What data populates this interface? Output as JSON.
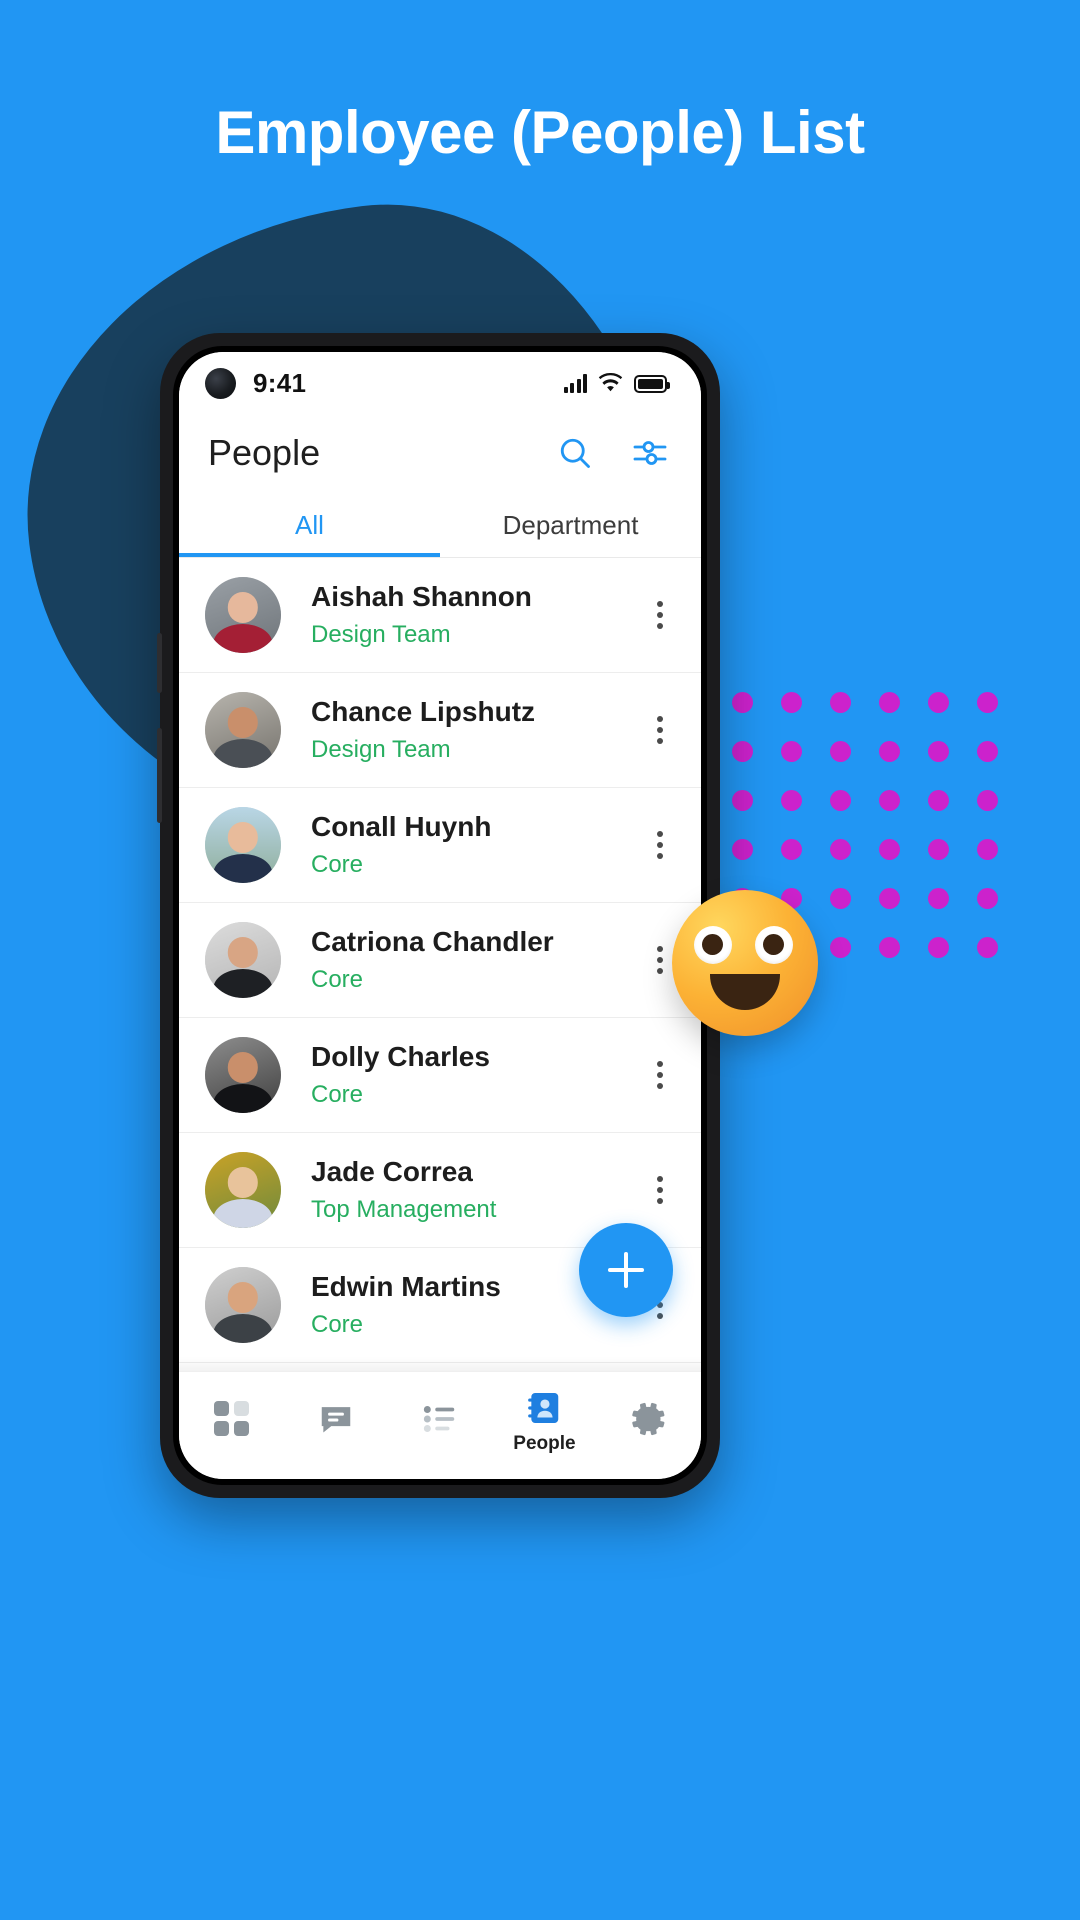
{
  "headline": "Employee (People) List",
  "colors": {
    "background": "#2196f3",
    "blob": "#18405e",
    "dots": "#cc22cc",
    "accent": "#2196f3",
    "department_green": "#27ae60"
  },
  "phone": {
    "status_bar": {
      "time": "9:41",
      "signal_icon": "signal-bars-icon",
      "wifi_icon": "wifi-icon",
      "battery_icon": "battery-full-icon"
    },
    "app_bar": {
      "title": "People",
      "search_icon": "search-icon",
      "filter_icon": "sliders-filter-icon"
    },
    "tabs": [
      {
        "label": "All",
        "active": true
      },
      {
        "label": "Department",
        "active": false
      }
    ],
    "people": [
      {
        "name": "Aishah Shannon",
        "department": "Design Team",
        "menu_icon": "kebab-menu-icon"
      },
      {
        "name": "Chance Lipshutz",
        "department": "Design Team",
        "menu_icon": "kebab-menu-icon"
      },
      {
        "name": "Conall Huynh",
        "department": "Core",
        "menu_icon": "kebab-menu-icon"
      },
      {
        "name": "Catriona Chandler",
        "department": "Core",
        "menu_icon": "kebab-menu-icon"
      },
      {
        "name": "Dolly Charles",
        "department": "Core",
        "menu_icon": "kebab-menu-icon"
      },
      {
        "name": "Jade Correa",
        "department": "Top Management",
        "menu_icon": "kebab-menu-icon"
      },
      {
        "name": "Edwin Martins",
        "department": "Core",
        "menu_icon": "kebab-menu-icon"
      }
    ],
    "fab": {
      "icon": "plus-icon"
    },
    "bottom_nav": [
      {
        "label": "",
        "icon": "grid-dashboard-icon",
        "active": false
      },
      {
        "label": "",
        "icon": "chat-bubble-icon",
        "active": false
      },
      {
        "label": "",
        "icon": "task-list-icon",
        "active": false
      },
      {
        "label": "People",
        "icon": "contact-book-icon",
        "active": true
      },
      {
        "label": "",
        "icon": "gear-settings-icon",
        "active": false
      }
    ]
  },
  "decor": {
    "emoji": "smiling-face-emoji"
  }
}
